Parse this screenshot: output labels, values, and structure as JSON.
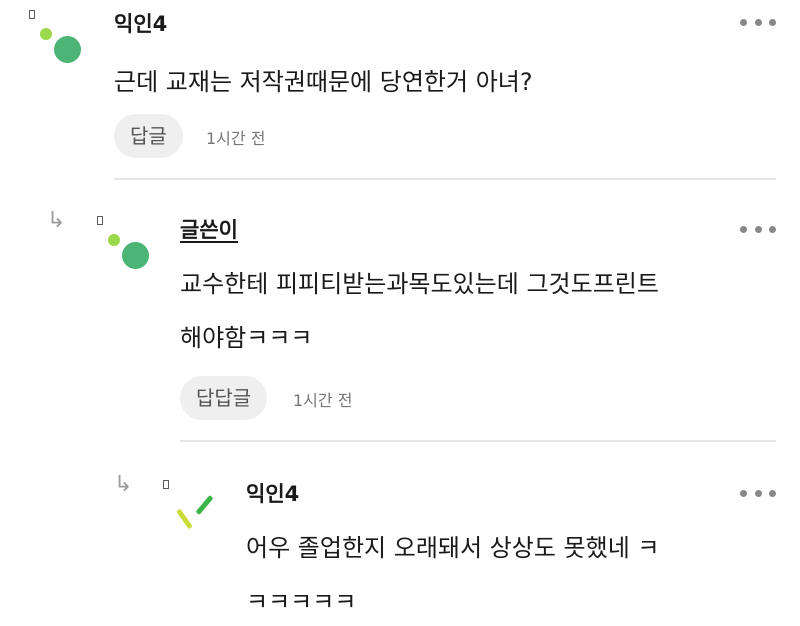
{
  "comments": [
    {
      "author": "익인4",
      "text_lines": [
        "근데 교재는 저작권때문에 당연한거 아녀?"
      ],
      "reply_label": "답글",
      "time": "1시간 전"
    },
    {
      "author": "글쓴이",
      "text_lines": [
        "교수한테 피피티받는과목도있는데 그것도프린트",
        "해야함ㅋㅋㅋ"
      ],
      "reply_label": "답답글",
      "time": "1시간 전"
    },
    {
      "author": "익인4",
      "text_lines": [
        "어우 졸업한지 오래돼서 상상도 못했네 ㅋ",
        "ㅋㅋㅋㅋㅋ"
      ]
    }
  ],
  "icons": {
    "reply_arrow": "reply-arrow-icon",
    "more": "more-options-icon",
    "avatar": "avatar"
  },
  "colors": {
    "avatar_green": "#4cb576",
    "avatar_lime": "#9ad84a",
    "reply_button_bg": "#efefef",
    "divider": "#e6e6e6"
  }
}
